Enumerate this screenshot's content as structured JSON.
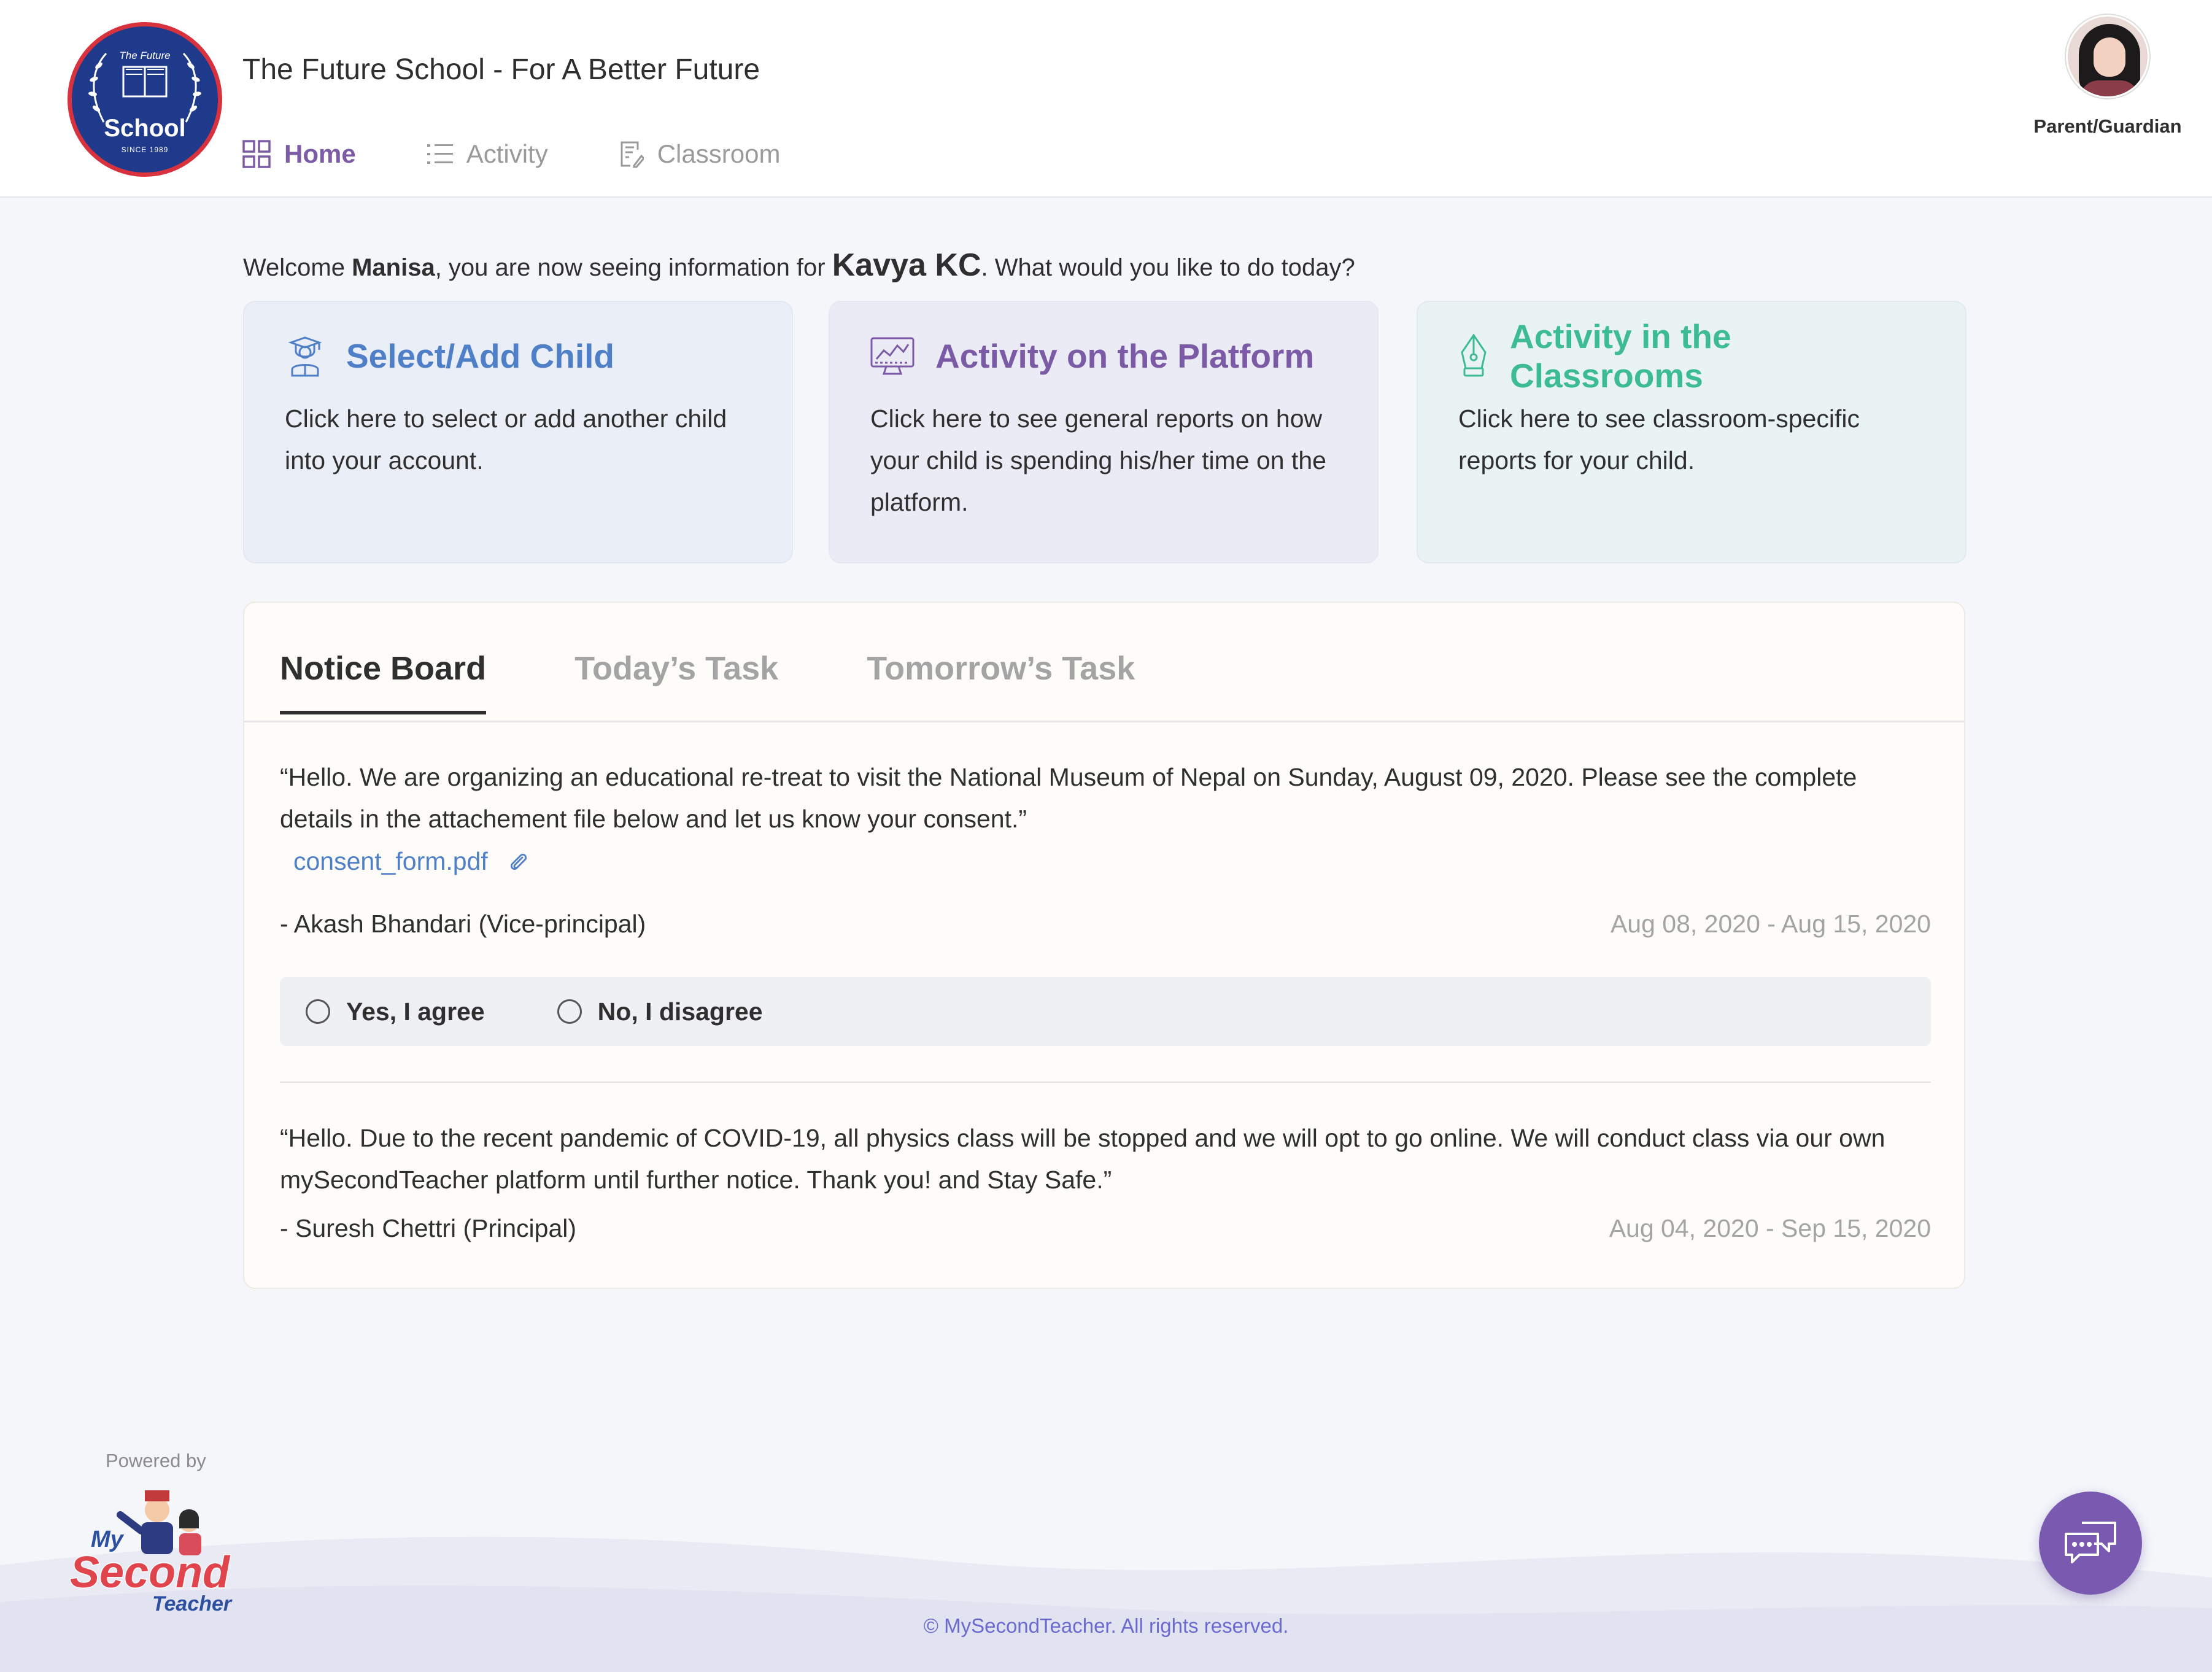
{
  "header": {
    "logo": {
      "top_text": "The Future",
      "name": "School",
      "since": "SINCE 1989"
    },
    "school_title": "The Future School - For A Better Future",
    "nav": [
      {
        "label": "Home",
        "icon": "grid-icon",
        "active": true
      },
      {
        "label": "Activity",
        "icon": "list-icon",
        "active": false
      },
      {
        "label": "Classroom",
        "icon": "document-edit-icon",
        "active": false
      }
    ],
    "user": {
      "role": "Parent/Guardian",
      "avatar": "user-avatar"
    }
  },
  "welcome": {
    "prefix": "Welcome ",
    "user_name": "Manisa",
    "middle": ", you are now seeing information for ",
    "child_name": "Kavya KC",
    "suffix": ". What would you like to do today?"
  },
  "cards": [
    {
      "title": "Select/Add Child",
      "icon": "student-icon",
      "desc": "Click here to select or add another child into your account.",
      "color": "#4f7fc6"
    },
    {
      "title": "Activity on the Platform",
      "icon": "monitor-chart-icon",
      "desc": "Click here to see general reports on how your child is spending his/her time on the platform.",
      "color": "#7b5aa6"
    },
    {
      "title": "Activity in the Classrooms",
      "icon": "pen-nib-icon",
      "desc": "Click here to see classroom-specific reports for your child.",
      "color": "#3dbb92"
    }
  ],
  "tabs": [
    {
      "label": "Notice Board",
      "active": true
    },
    {
      "label": "Today’s Task",
      "active": false
    },
    {
      "label": "Tomorrow’s Task",
      "active": false
    }
  ],
  "notices": [
    {
      "text": "“Hello. We are organizing an educational re-treat to visit the National Museum of Nepal on Sunday, August 09, 2020. Please see the complete details in the attachement file below and let us know your consent.”",
      "attachment": "consent_form.pdf",
      "author": "- Akash Bhandari (Vice-principal)",
      "dates": "Aug 08, 2020 - Aug 15, 2020",
      "options": [
        "Yes, I agree",
        "No, I disagree"
      ]
    },
    {
      "text": "“Hello. Due to the recent pandemic of COVID-19, all physics class will be stopped and we will opt to go online. We will conduct class via our own mySecondTeacher platform until further notice. Thank you! and Stay Safe.”",
      "author": "- Suresh Chettri (Principal)",
      "dates": "Aug 04, 2020  - Sep 15, 2020"
    }
  ],
  "footer": {
    "powered_by": "Powered by",
    "brand_logo": {
      "line1": "My",
      "line2": "Second",
      "line3": "Teacher"
    },
    "copyright": "© MySecondTeacher. All rights reserved.",
    "chat_icon": "chat-bubbles-icon"
  },
  "colors": {
    "accent_purple": "#7b5aa6",
    "accent_blue": "#4f7fc6",
    "accent_green": "#3dbb92",
    "chat_button": "#7a5ab0"
  }
}
